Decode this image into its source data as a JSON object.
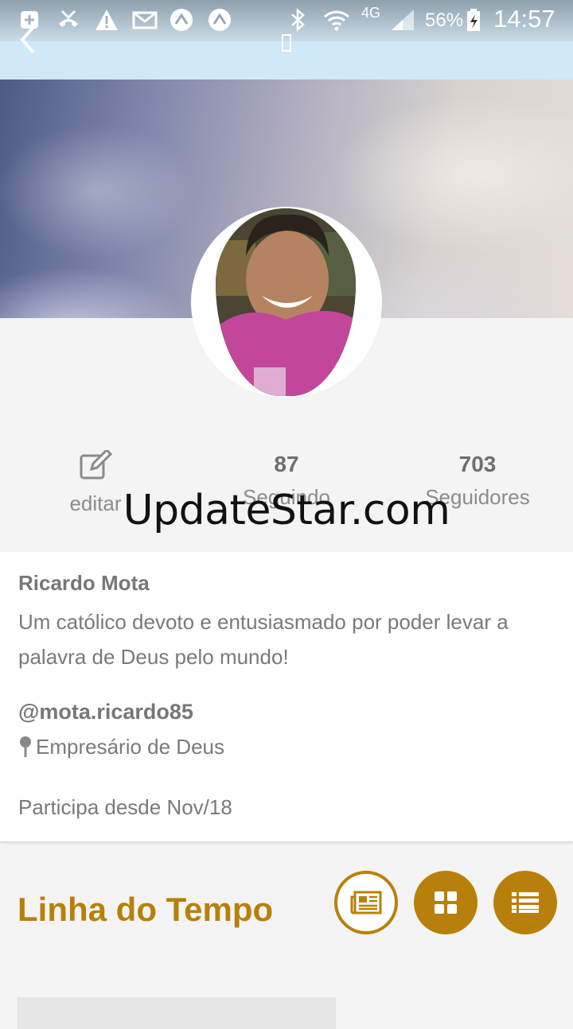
{
  "status_bar": {
    "battery": "56%",
    "time": "14:57",
    "network": "4G"
  },
  "profile": {
    "stats": {
      "edit_label": "editar",
      "following_count": "87",
      "following_label": "Seguindo",
      "followers_count": "703",
      "followers_label": "Seguidores"
    },
    "name": "Ricardo Mota",
    "bio": "Um católico devoto e entusiasmado por poder levar a palavra de Deus pelo mundo!",
    "handle": "@mota.ricardo85",
    "location": "Empresário de Deus",
    "member_since": "Participa desde Nov/18"
  },
  "watermark": "UpdateStar.com",
  "timeline": {
    "title": "Linha do Tempo",
    "view_buttons": [
      "news-view",
      "grid-view",
      "list-view"
    ]
  },
  "colors": {
    "accent": "#b8800a",
    "appbar": "#cfe9f8"
  },
  "icons": [
    "add-icon",
    "missed-call-icon",
    "warning-icon",
    "mail-icon",
    "app-icon",
    "bluetooth-icon",
    "wifi-icon",
    "signal-icon",
    "battery-icon",
    "back-arrow-icon",
    "edit-icon",
    "location-pin-icon",
    "newspaper-icon",
    "grid-icon",
    "list-icon"
  ]
}
